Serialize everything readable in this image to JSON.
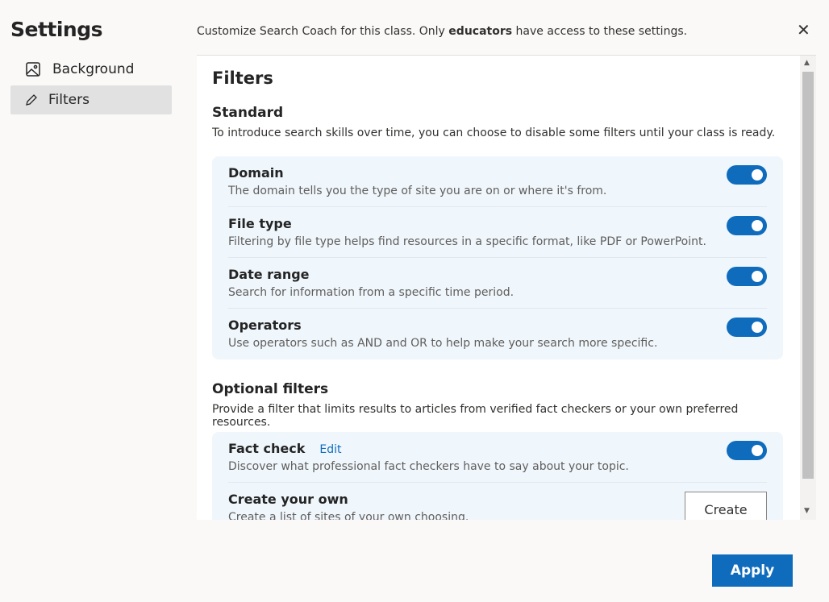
{
  "sidebar": {
    "title": "Settings",
    "items": [
      {
        "label": "Background",
        "icon": "image-icon"
      },
      {
        "label": "Filters",
        "icon": "pencil-icon",
        "active": true
      }
    ]
  },
  "header": {
    "description_pre": "Customize Search Coach for this class. Only ",
    "description_bold": "educators",
    "description_post": " have access to these settings."
  },
  "main": {
    "title": "Filters",
    "standard": {
      "heading": "Standard",
      "description": "To introduce search skills over time, you can choose to disable some filters until your class is ready.",
      "items": [
        {
          "title": "Domain",
          "description": "The domain tells you the type of site you are on or where it's from.",
          "enabled": true
        },
        {
          "title": "File type",
          "description": "Filtering by file type helps find resources in a specific format, like PDF or PowerPoint.",
          "enabled": true
        },
        {
          "title": "Date range",
          "description": "Search for information from a specific time period.",
          "enabled": true
        },
        {
          "title": "Operators",
          "description": "Use operators such as AND and OR to help make your search more specific.",
          "enabled": true
        }
      ]
    },
    "optional": {
      "heading": "Optional filters",
      "description": "Provide a filter that limits results to articles from verified fact checkers or your own preferred resources.",
      "fact_check": {
        "title": "Fact check",
        "edit_label": "Edit",
        "description": "Discover what professional fact checkers have to say about your topic.",
        "enabled": true
      },
      "create_own": {
        "title": "Create your own",
        "description": "Create a list of sites of your own choosing.",
        "button": "Create"
      }
    }
  },
  "footer": {
    "apply_label": "Apply"
  },
  "colors": {
    "accent": "#0f6cbd",
    "card": "#eff6fc",
    "background": "#faf9f8"
  }
}
